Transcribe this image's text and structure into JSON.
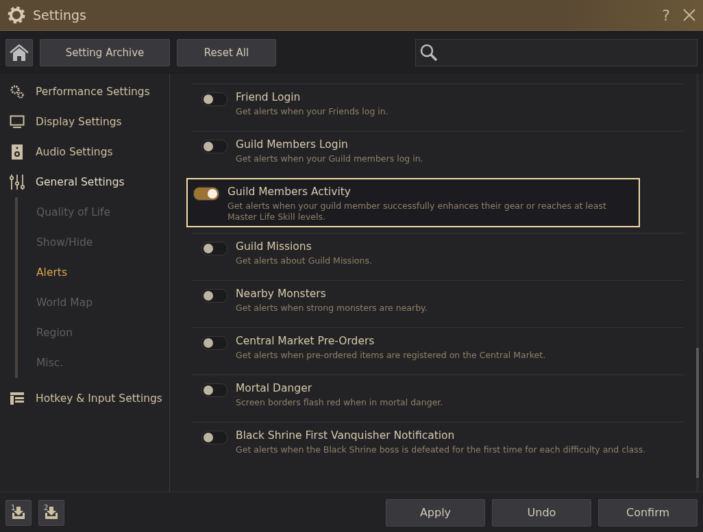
{
  "window": {
    "title": "Settings",
    "help": "?"
  },
  "toolbar": {
    "buttons": [
      "Setting Archive",
      "Reset All"
    ]
  },
  "sidebar": {
    "items": [
      {
        "label": "Performance Settings",
        "kind": "gears",
        "expanded": false
      },
      {
        "label": "Display Settings",
        "kind": "monitor",
        "expanded": false
      },
      {
        "label": "Audio Settings",
        "kind": "speaker",
        "expanded": false
      },
      {
        "label": "General Settings",
        "kind": "sliders",
        "expanded": true,
        "children": [
          {
            "label": "Quality of Life",
            "selected": false
          },
          {
            "label": "Show/Hide",
            "selected": false
          },
          {
            "label": "Alerts",
            "selected": true
          },
          {
            "label": "World Map",
            "selected": false
          },
          {
            "label": "Region",
            "selected": false
          },
          {
            "label": "Misc.",
            "selected": false
          }
        ]
      },
      {
        "label": "Hotkey & Input Settings",
        "kind": "layout",
        "expanded": false
      }
    ]
  },
  "alerts": [
    {
      "title": "Friend Login",
      "description": "Get alerts when your Friends log in.",
      "on": false,
      "selected": false
    },
    {
      "title": "Guild Members Login",
      "description": "Get alerts when your Guild members log in.",
      "on": false,
      "selected": false
    },
    {
      "title": "Guild Members Activity",
      "description": "Get alerts when your guild member successfully enhances their gear or reaches at least Master Life Skill levels.",
      "on": true,
      "selected": true
    },
    {
      "title": "Guild Missions",
      "description": "Get alerts about Guild Missions.",
      "on": false,
      "selected": false
    },
    {
      "title": "Nearby Monsters",
      "description": "Get alerts when strong monsters are nearby.",
      "on": false,
      "selected": false
    },
    {
      "title": "Central Market Pre-Orders",
      "description": "Get alerts when pre-ordered items are registered on the Central Market.",
      "on": false,
      "selected": false
    },
    {
      "title": "Mortal Danger",
      "description": "Screen borders flash red when in mortal danger.",
      "on": false,
      "selected": false
    },
    {
      "title": "Black Shrine First Vanquisher Notification",
      "description": "Get alerts when the Black Shrine boss is defeated for the first time for each difficulty and class.",
      "on": false,
      "selected": false
    }
  ],
  "footer": {
    "presets": [
      "1",
      "2"
    ],
    "buttons": [
      "Apply",
      "Undo",
      "Confirm"
    ]
  }
}
